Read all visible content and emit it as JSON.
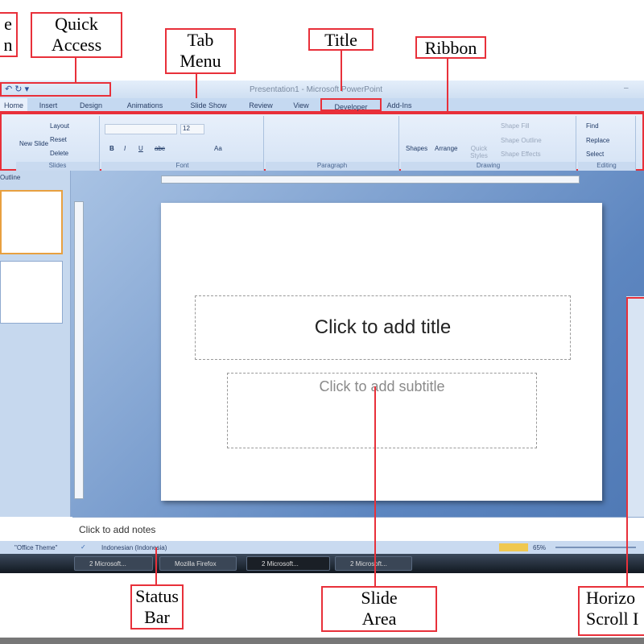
{
  "annotations": {
    "office_button": "e\nn",
    "quick_access": "Quick\nAccess",
    "tab_menu": "Tab\nMenu",
    "title": "Title",
    "ribbon": "Ribbon",
    "status_bar": "Status\nBar",
    "slide_area": "Slide\nArea",
    "scroll_bar": "Horizo\nScroll I"
  },
  "window": {
    "title": "Presentation1 - Microsoft PowerPoint"
  },
  "tabs": [
    "Home",
    "Insert",
    "Design",
    "Animations",
    "Slide Show",
    "Review",
    "View",
    "Developer",
    "Add-Ins"
  ],
  "ribbon": {
    "slides": {
      "label": "Slides",
      "new_slide": "New Slide",
      "layout": "Layout",
      "reset": "Reset",
      "delete": "Delete"
    },
    "font": {
      "label": "Font",
      "size": "12",
      "bold": "B",
      "italic": "I",
      "underline": "U",
      "strike": "abc",
      "case": "Aa"
    },
    "paragraph": {
      "label": "Paragraph"
    },
    "drawing": {
      "label": "Drawing",
      "shapes": "Shapes",
      "arrange": "Arrange",
      "quick_styles": "Quick Styles",
      "shape_fill": "Shape Fill",
      "shape_outline": "Shape Outline",
      "shape_effects": "Shape Effects"
    },
    "editing": {
      "label": "Editing",
      "find": "Find",
      "replace": "Replace",
      "select": "Select"
    }
  },
  "side_panel": {
    "outline_tab": "Outline"
  },
  "slide": {
    "title_placeholder": "Click to add title",
    "subtitle_placeholder": "Click to add subtitle"
  },
  "notes": {
    "placeholder": "Click to add notes"
  },
  "status": {
    "theme": "\"Office Theme\"",
    "language": "Indonesian (Indonesia)",
    "zoom": "65%"
  },
  "taskbar": [
    "2 Microsoft...",
    "Mozilla Firefox",
    "2 Microsoft...",
    "2 Microsoft..."
  ],
  "colors": {
    "annotation": "#e8303a",
    "ribbon": "#d5e3f5",
    "workspace": "#5d86c0"
  }
}
